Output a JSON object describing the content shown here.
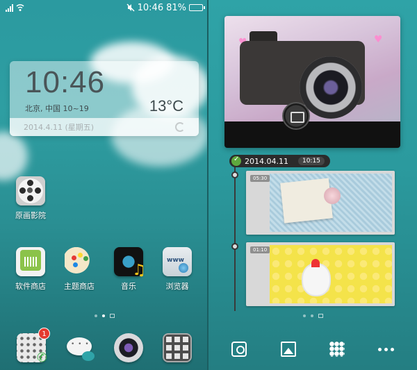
{
  "status_bar": {
    "time": "10:46",
    "battery": "81%",
    "battery_level": 0.81
  },
  "clock_widget": {
    "time": "10:46",
    "city": "北京, 中国  10~19",
    "temperature": "13°C",
    "date": "2014.4.11 (星期五)"
  },
  "left_apps": [
    {
      "label": "原画影院",
      "icon": "film-reel-icon"
    },
    {
      "label": "软件商店",
      "icon": "software-store-icon"
    },
    {
      "label": "主题商店",
      "icon": "palette-icon"
    },
    {
      "label": "音乐",
      "icon": "music-icon"
    },
    {
      "label": "浏览器",
      "icon": "browser-icon"
    }
  ],
  "dock": {
    "dialer_badge": "1",
    "items": [
      "dialer-icon",
      "messages-icon",
      "camera-icon",
      "app-drawer-icon"
    ]
  },
  "gallery": {
    "date": "2014.04.11",
    "time": "10:15",
    "entries": [
      {
        "time": "05:30",
        "thumb": "book-flower-photo"
      },
      {
        "time": "01:10",
        "thumb": "chicks-photo"
      }
    ]
  },
  "bottom_bar": [
    "camera-icon",
    "gallery-icon",
    "grid-icon",
    "more-icon"
  ],
  "colors": {
    "accent_green": "#5ea83d",
    "badge_red": "#e43a2f",
    "teal": "#2b9aa0"
  }
}
